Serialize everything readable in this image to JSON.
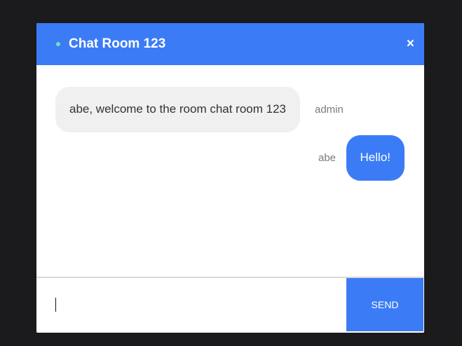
{
  "header": {
    "title": "Chat Room 123",
    "close_label": "×"
  },
  "messages": [
    {
      "sender": "admin",
      "text": "abe, welcome to the room chat room 123",
      "direction": "incoming"
    },
    {
      "sender": "abe",
      "text": "Hello!",
      "direction": "outgoing"
    }
  ],
  "composer": {
    "value": "",
    "placeholder": "",
    "send_label": "SEND"
  },
  "colors": {
    "accent": "#3b7cf6",
    "status_online": "#6fe3b5",
    "background": "#1b1b1d"
  }
}
